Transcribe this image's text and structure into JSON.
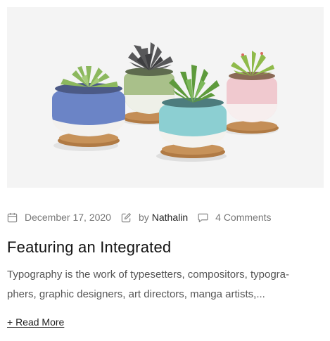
{
  "post": {
    "image_alt": "Four ceramic succulent pots on bamboo saucers",
    "date": "December 17, 2020",
    "by_prefix": "by",
    "author": "Nathalin",
    "comments": "4 Comments",
    "title": "Featuring an Integrated",
    "excerpt_lines": [
      "Typography is the work of typesetters, compositors, typogra-",
      "phers, graphic designers, art directors, manga artists,..."
    ],
    "read_more": "+ Read More"
  },
  "icons": {
    "date": "calendar-icon",
    "author": "pencil-edit-icon",
    "comments": "speech-bubble-icon"
  },
  "colors": {
    "background": "#ffffff",
    "image_bg": "#f4f4f4",
    "meta_text": "#777777",
    "heading": "#111111",
    "body_text": "#555555"
  }
}
